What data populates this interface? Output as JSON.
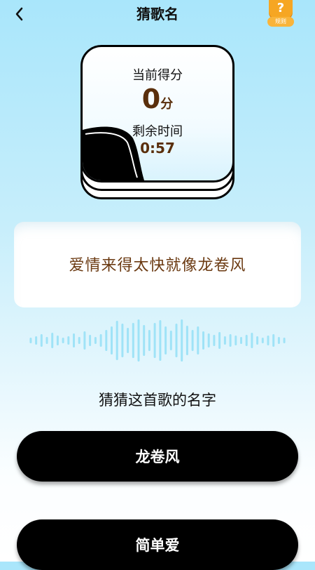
{
  "header": {
    "title": "猜歌名",
    "rules_label": "规则",
    "rules_icon": "?"
  },
  "score_card": {
    "score_label": "当前得分",
    "score_value": "0",
    "score_unit": "分",
    "time_label": "剩余时间",
    "time_value": "0:57"
  },
  "lyric": "爱情来得太快就像龙卷风",
  "question": "猜猜这首歌的名字",
  "options": [
    {
      "label": "龙卷风"
    },
    {
      "label": "简单爱"
    }
  ],
  "colors": {
    "accent": "#f6a623",
    "brown": "#5a2f0c",
    "wave": "#9fe3f7"
  }
}
